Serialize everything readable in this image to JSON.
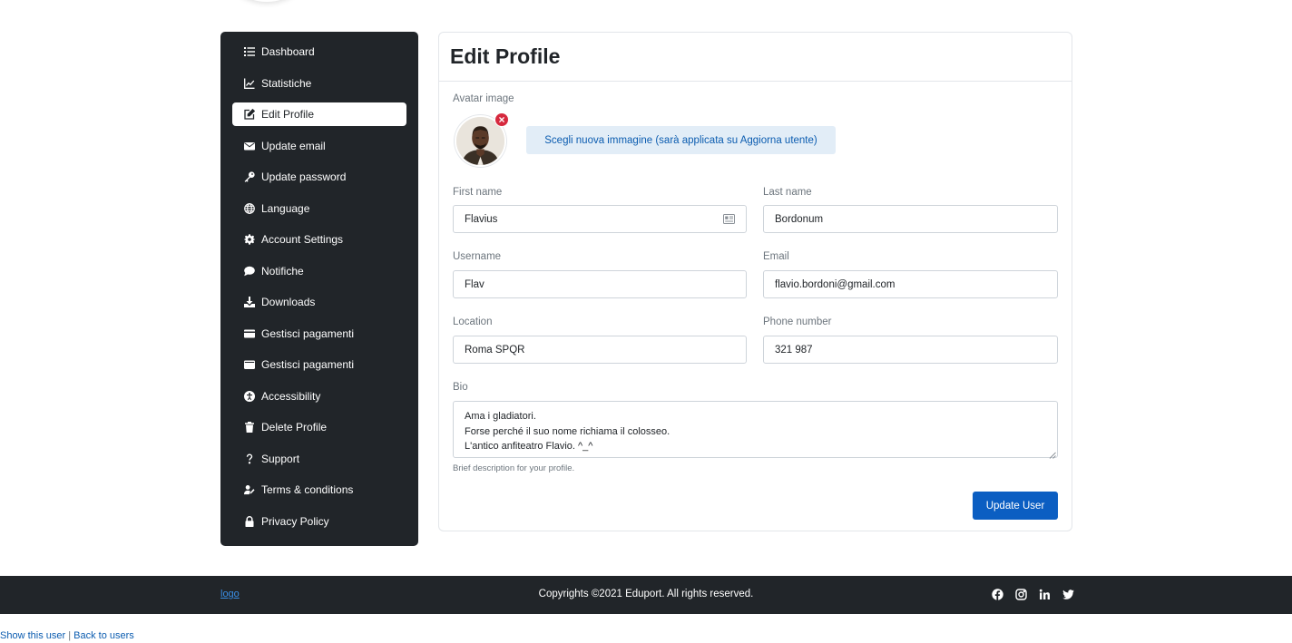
{
  "sidebar": {
    "items": [
      {
        "label": "Dashboard",
        "icon": "list-icon"
      },
      {
        "label": "Statistiche",
        "icon": "chart-line-icon"
      },
      {
        "label": "Edit Profile",
        "icon": "edit-icon",
        "active": true
      },
      {
        "label": "Update email",
        "icon": "envelope-icon"
      },
      {
        "label": "Update password",
        "icon": "key-icon"
      },
      {
        "label": "Language",
        "icon": "globe-icon"
      },
      {
        "label": "Account Settings",
        "icon": "gear-icon"
      },
      {
        "label": "Notifiche",
        "icon": "chat-bubble-icon"
      },
      {
        "label": "Downloads",
        "icon": "download-icon"
      },
      {
        "label": "Gestisci pagamenti",
        "icon": "credit-card-icon"
      },
      {
        "label": "Gestisci pagamenti",
        "icon": "wallet-icon"
      },
      {
        "label": "Accessibility",
        "icon": "accessibility-icon"
      },
      {
        "label": "Delete Profile",
        "icon": "trash-icon"
      },
      {
        "label": "Support",
        "icon": "question-icon"
      },
      {
        "label": "Terms & conditions",
        "icon": "user-edit-icon"
      },
      {
        "label": "Privacy Policy",
        "icon": "lock-icon"
      }
    ]
  },
  "form": {
    "title": "Edit Profile",
    "avatar_label": "Avatar image",
    "remove_symbol": "×",
    "choose_image_label": "Scegli nuova immagine (sarà applicata su Aggiorna utente)",
    "first_name": {
      "label": "First name",
      "value": "Flavius"
    },
    "last_name": {
      "label": "Last name",
      "value": "Bordonum"
    },
    "username": {
      "label": "Username",
      "value": "Flav"
    },
    "email": {
      "label": "Email",
      "value": "flavio.bordoni@gmail.com"
    },
    "location": {
      "label": "Location",
      "value": "Roma SPQR"
    },
    "phone": {
      "label": "Phone number",
      "value": "321 987"
    },
    "bio": {
      "label": "Bio",
      "lines": [
        "Ama i gladiatori.",
        "Forse perché il suo nome richiama il colosseo.",
        "L'antico anfiteatro Flavio. ^_^"
      ],
      "help": "Brief description for your profile."
    },
    "submit_label": "Update User"
  },
  "footer": {
    "logo_alt": "logo",
    "copyright": "Copyrights ©2021 Eduport. All rights reserved.",
    "socials": [
      "facebook-icon",
      "instagram-icon",
      "linkedin-icon",
      "twitter-icon"
    ]
  },
  "links": {
    "show": "Show this user",
    "separator": "|",
    "back": "Back to users"
  },
  "colors": {
    "sidebar_bg": "#212529",
    "primary": "#0b5ec2",
    "danger": "#d6293e",
    "soft_primary_bg": "#e2edf7"
  }
}
